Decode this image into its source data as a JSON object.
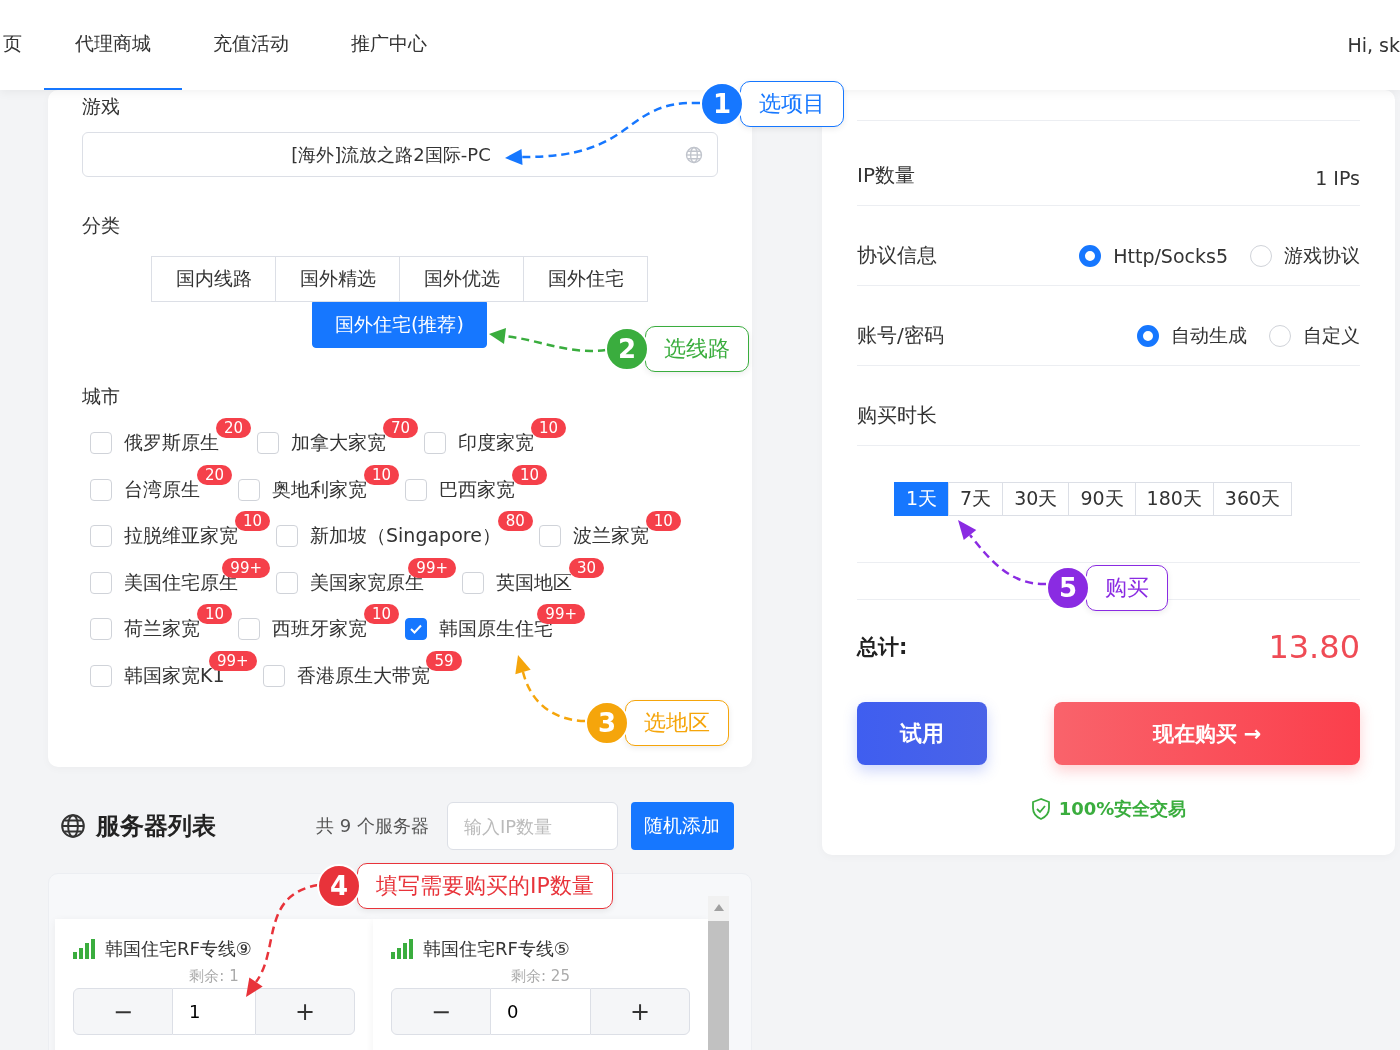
{
  "nav": {
    "tabs": [
      {
        "label": "页",
        "selected": false
      },
      {
        "label": "代理商城",
        "selected": true
      },
      {
        "label": "充值活动",
        "selected": false
      },
      {
        "label": "推广中心",
        "selected": false
      }
    ],
    "greeting": "Hi, sk"
  },
  "game": {
    "label": "游戏",
    "value": "[海外]流放之路2国际-PC"
  },
  "category": {
    "label": "分类",
    "options": [
      {
        "label": "国内线路",
        "selected": false
      },
      {
        "label": "国外精选",
        "selected": false
      },
      {
        "label": "国外优选",
        "selected": false
      },
      {
        "label": "国外住宅",
        "selected": false
      },
      {
        "label": "国外住宅(推荐)",
        "selected": true
      }
    ]
  },
  "city": {
    "label": "城市",
    "options": [
      {
        "name": "俄罗斯原生",
        "count": "20",
        "checked": false
      },
      {
        "name": "加拿大家宽",
        "count": "70",
        "checked": false
      },
      {
        "name": "印度家宽",
        "count": "10",
        "checked": false
      },
      {
        "name": "台湾原生",
        "count": "20",
        "checked": false
      },
      {
        "name": "奥地利家宽",
        "count": "10",
        "checked": false
      },
      {
        "name": "巴西家宽",
        "count": "10",
        "checked": false
      },
      {
        "name": "拉脱维亚家宽",
        "count": "10",
        "checked": false
      },
      {
        "name": "新加坡（Singapore）",
        "count": "80",
        "checked": false
      },
      {
        "name": "波兰家宽",
        "count": "10",
        "checked": false
      },
      {
        "name": "美国住宅原生",
        "count": "99+",
        "checked": false
      },
      {
        "name": "美国家宽原生",
        "count": "99+",
        "checked": false
      },
      {
        "name": "英国地区",
        "count": "30",
        "checked": false
      },
      {
        "name": "荷兰家宽",
        "count": "10",
        "checked": false
      },
      {
        "name": "西班牙家宽",
        "count": "10",
        "checked": false
      },
      {
        "name": "韩国原生住宅",
        "count": "99+",
        "checked": true
      },
      {
        "name": "韩国家宽K1",
        "count": "99+",
        "checked": false
      },
      {
        "name": "香港原生大带宽",
        "count": "59",
        "checked": false
      }
    ]
  },
  "server_list": {
    "title": "服务器列表",
    "count_text": "共 9 个服务器",
    "ip_input": {
      "placeholder": "输入IP数量"
    },
    "random_button": "随机添加",
    "servers": [
      {
        "name": "韩国住宅RF专线⑨",
        "remaining": "剩余: 1",
        "decrement": "−",
        "quantity": "1",
        "increment": "+"
      },
      {
        "name": "韩国住宅RF专线⑤",
        "remaining": "剩余: 25",
        "decrement": "−",
        "quantity": "0",
        "increment": "+"
      }
    ]
  },
  "order": {
    "rows": [
      {
        "kind": "value",
        "label": "IP数量",
        "value": "1 IPs"
      },
      {
        "kind": "radio",
        "label": "协议信息",
        "options": [
          {
            "label": "Http/Socks5",
            "selected": true
          },
          {
            "label": "游戏协议",
            "selected": false
          }
        ]
      },
      {
        "kind": "radio",
        "label": "账号/密码",
        "options": [
          {
            "label": "自动生成",
            "selected": true
          },
          {
            "label": "自定义",
            "selected": false
          }
        ]
      },
      {
        "kind": "heading",
        "label": "购买时长"
      }
    ],
    "durations": [
      {
        "label": "1天",
        "selected": true
      },
      {
        "label": "7天",
        "selected": false
      },
      {
        "label": "30天",
        "selected": false
      },
      {
        "label": "90天",
        "selected": false
      },
      {
        "label": "180天",
        "selected": false
      },
      {
        "label": "360天",
        "selected": false
      }
    ],
    "total_label": "总计:",
    "total": "13.80",
    "trial_button": "试用",
    "buy_button": "现在购买 →",
    "secure_note": "100%安全交易"
  },
  "annotations": [
    {
      "number": "1",
      "label": "选项目",
      "color": "#1677ff"
    },
    {
      "number": "2",
      "label": "选线路",
      "color": "#3aad3e"
    },
    {
      "number": "3",
      "label": "选地区",
      "color": "#f5a50b"
    },
    {
      "number": "4",
      "label": "填写需要购买的IP数量",
      "color": "#e8333a"
    },
    {
      "number": "5",
      "label": "购买",
      "color": "#8a2be2"
    }
  ]
}
